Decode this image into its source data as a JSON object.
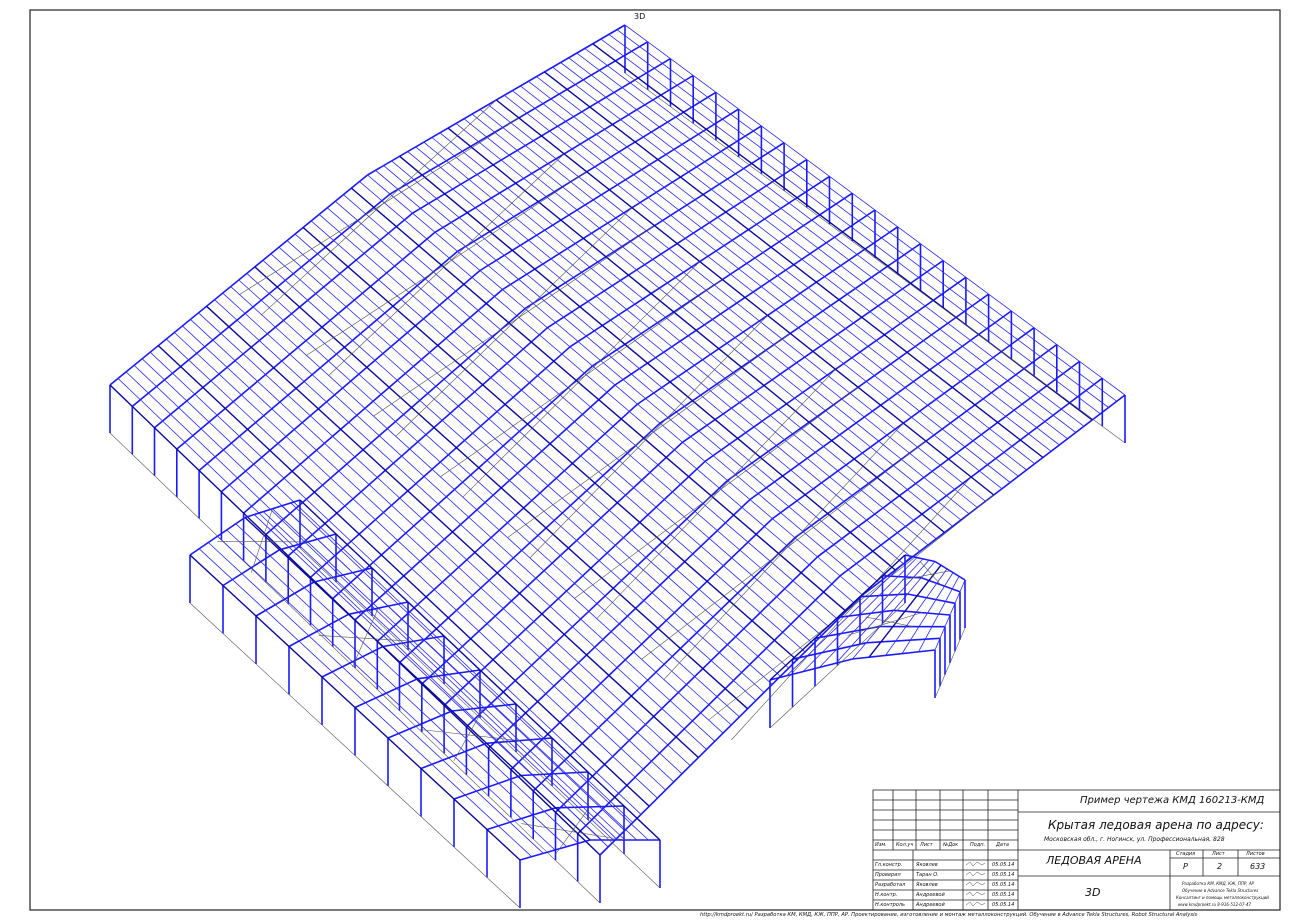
{
  "view_label": "3D",
  "title_block": {
    "doc_code": "Пример чертежа КМД 160213-КМД",
    "project_title": "Крытая ледовая арена по адресу:",
    "address": "Московская обл., г. Ногинск, ул. Профессиональная, 828",
    "sheet_title": "ЛЕДОВАЯ АРЕНА",
    "view_name": "3D",
    "header_cols": [
      "Изм.",
      "Кол.уч",
      "Лист",
      "№Док",
      "Подп.",
      "Дата"
    ],
    "roles": [
      {
        "role": "Гл.констр.",
        "name": "Яковлев",
        "date": "05.05.14"
      },
      {
        "role": "Проверил",
        "name": "Таран О.",
        "date": "05.05.14"
      },
      {
        "role": "Разработал",
        "name": "Яковлев",
        "date": "05.05.14"
      },
      {
        "role": "Н.контр.",
        "name": "Андреевой",
        "date": "05.05.14"
      },
      {
        "role": "Н.контроль",
        "name": "Андреевой",
        "date": "05.05.14"
      }
    ],
    "stage_label": "Стадия",
    "sheet_label": "Лист",
    "sheets_label": "Листов",
    "stage": "Р",
    "sheet": "2",
    "sheets": "633",
    "company_lines": [
      "Разработка КМ, КМД, КЖ, ППР, АР",
      "Обучение в Advance Tekla Structures",
      "Консалтинг и помощь металлоконструкций",
      "www.kmdproekt.ru   8-916-512-07-47"
    ]
  },
  "footer_note": "http://kmdproekt.ru/   Разработка КМ, КМД, КЖ, ППР, АР. Проектирование, изготовление и монтаж металлоконструкций. Обучение в Advance Tekla Structures, Robot Structural Analysis"
}
